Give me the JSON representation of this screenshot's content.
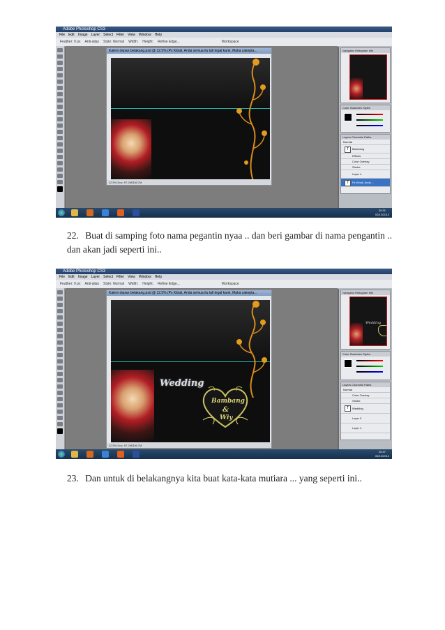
{
  "steps": [
    {
      "number": "22.",
      "text": "Buat di samping foto nama pegantin nyaa .. dan beri gambar di nama pengantin .. dan akan jadi seperti ini.."
    },
    {
      "number": "23.",
      "text": "Dan untuk di belakangnya kita buat kata-kata mutiara ... yang seperti ini.."
    }
  ],
  "screenshot1": {
    "app_title": "Adobe Photoshop CS3",
    "menu": [
      "File",
      "Edit",
      "Image",
      "Layer",
      "Select",
      "Filter",
      "View",
      "Window",
      "Help"
    ],
    "options": [
      "Feather: 0 px",
      "Anti-alias",
      "Style: Normal",
      "Width:",
      "Height:",
      "Refine Edge...",
      "Workspace"
    ],
    "doc_title": "Kalem depan belakang.psd @ 12.5% (Ps Kibali, Anda semua itu tali tegal kami, Maka cakepta...",
    "doc_status": "12.5%   Doc: 97.2M/336.7M",
    "panels": {
      "navigator_tabs": "Navigator  Histogram  Info",
      "color_tabs": "Color  Swatches  Styles",
      "layers_tabs": "Layers  Channels  Paths",
      "blend": "Normal",
      "layers": [
        "Bambang",
        "Effects",
        "Color Overlay",
        "Stroke",
        "Layer 4",
        "Ps Kibali, Anda ..."
      ]
    },
    "clock_time": "20:31",
    "clock_date": "02/12/2012"
  },
  "screenshot2": {
    "app_title": "Adobe Photoshop CS3",
    "menu": [
      "File",
      "Edit",
      "Image",
      "Layer",
      "Select",
      "Filter",
      "View",
      "Window",
      "Help"
    ],
    "options": [
      "Feather: 0 px",
      "Anti-alias",
      "Style: Normal",
      "Width:",
      "Height:",
      "Refine Edge...",
      "Workspace"
    ],
    "doc_title": "Kalem depan belakang.psd @ 12.5% (Ps Kibali, Anda semua itu tali tegal kami, Maka cakepta...",
    "doc_status": "12.5%   Doc: 97.2M/336.7M",
    "wedding_text": "Wedding",
    "couple_top": "Bambang",
    "couple_amp": "&",
    "couple_bottom": "Wiy",
    "panels": {
      "navigator_tabs": "Navigator  Histogram  Info",
      "color_tabs": "Color  Swatches  Styles",
      "layers_tabs": "Layers  Channels  Paths",
      "blend": "Normal",
      "layers": [
        "Color Overlay",
        "Stroke",
        "Wedding",
        "Layer 5",
        "Layer 4"
      ]
    },
    "clock_time": "20:47",
    "clock_date": "02/12/2012"
  }
}
